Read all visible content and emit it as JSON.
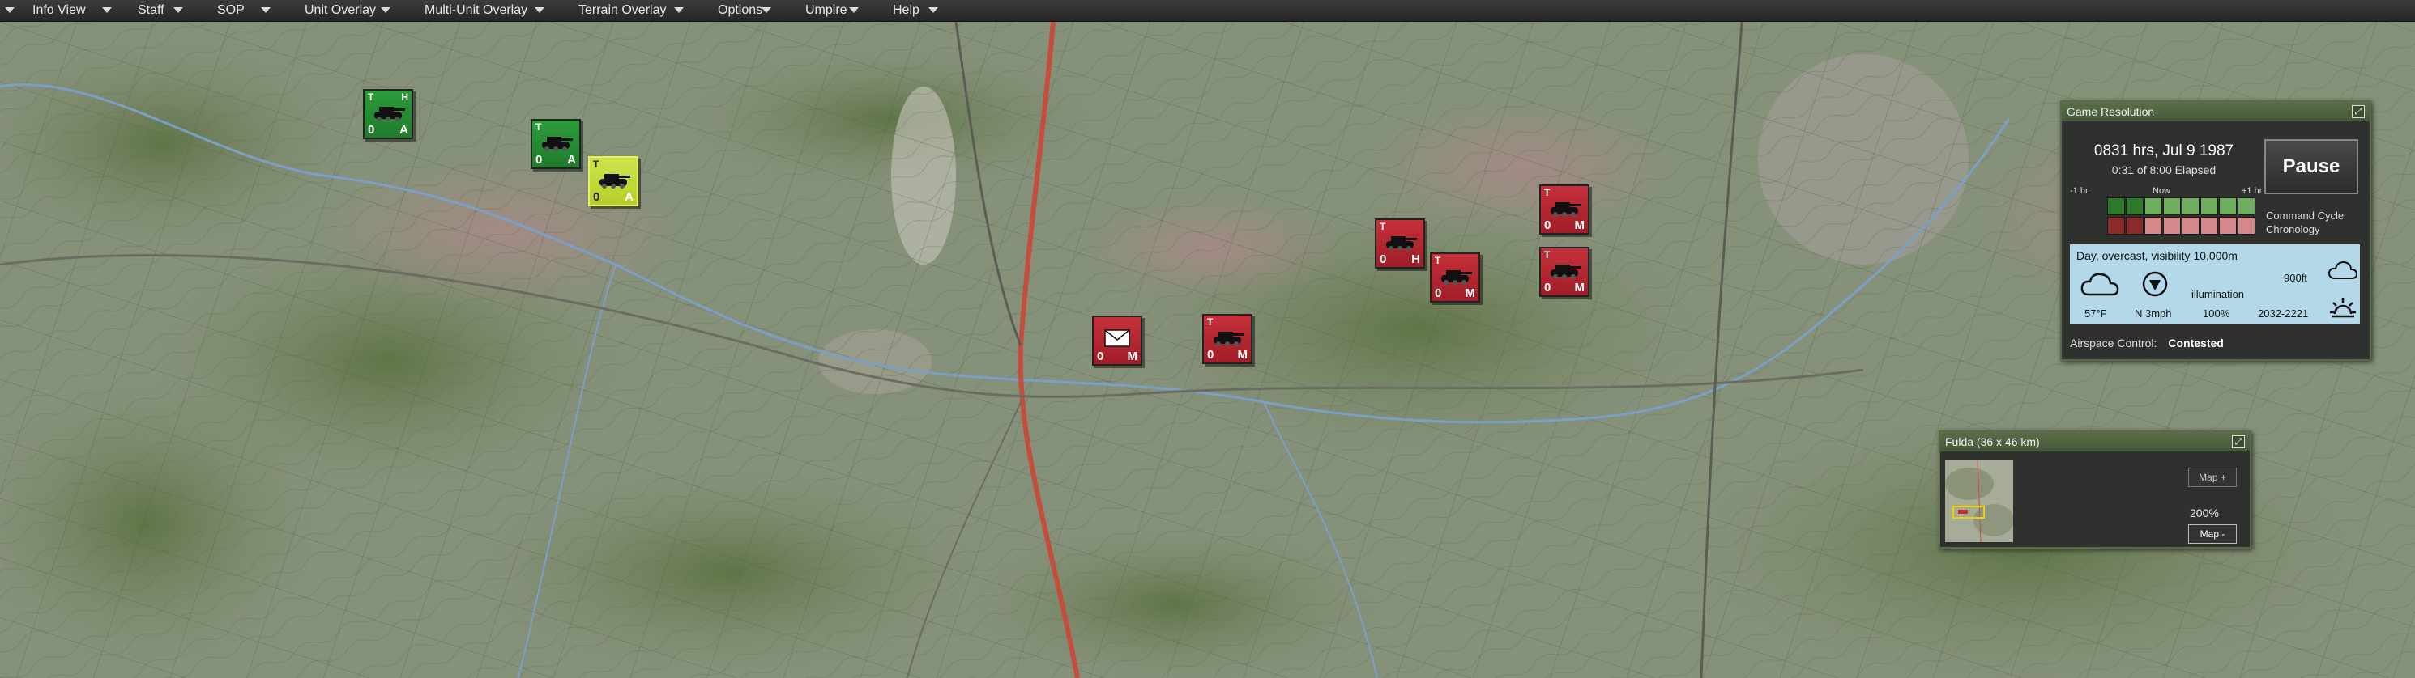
{
  "menu": {
    "items": [
      {
        "label": "Info View"
      },
      {
        "label": "Staff"
      },
      {
        "label": "SOP"
      },
      {
        "label": "Unit Overlay"
      },
      {
        "label": "Multi-Unit Overlay"
      },
      {
        "label": "Terrain Overlay"
      },
      {
        "label": "Options"
      },
      {
        "label": "Umpire"
      },
      {
        "label": "Help"
      }
    ]
  },
  "units": [
    {
      "side": "green",
      "top": "T",
      "top_right": "H",
      "strength": "0",
      "status": "A",
      "icon": "tank-icon"
    },
    {
      "side": "green",
      "top": "T",
      "top_right": "",
      "strength": "0",
      "status": "A",
      "icon": "tank-icon"
    },
    {
      "side": "yellow",
      "top": "T",
      "top_right": "",
      "strength": "0",
      "status": "A",
      "icon": "tank-icon"
    },
    {
      "side": "red",
      "top": "",
      "top_right": "",
      "strength": "0",
      "status": "M",
      "icon": "hq-envelope-icon"
    },
    {
      "side": "red",
      "top": "T",
      "top_right": "",
      "strength": "0",
      "status": "M",
      "icon": "tank-icon"
    },
    {
      "side": "red",
      "top": "T",
      "top_right": "",
      "strength": "0",
      "status": "H",
      "icon": "tank-icon"
    },
    {
      "side": "red",
      "top": "T",
      "top_right": "",
      "strength": "0",
      "status": "M",
      "icon": "tank-icon"
    },
    {
      "side": "red",
      "top": "T",
      "top_right": "",
      "strength": "0",
      "status": "M",
      "icon": "tank-icon"
    },
    {
      "side": "red",
      "top": "T",
      "top_right": "",
      "strength": "0",
      "status": "M",
      "icon": "tank-icon"
    }
  ],
  "game_resolution": {
    "title": "Game Resolution",
    "time": "0831 hrs, Jul 9 1987",
    "elapsed": "0:31 of 8:00 Elapsed",
    "pause_label": "Pause",
    "chron_minus": "-1 hr",
    "chron_now": "Now",
    "chron_plus": "+1 hr",
    "command_cycle": "Command Cycle",
    "chronology": "Chronology",
    "weather_text": "Day, overcast, visibility 10,000m",
    "temperature": "57°F",
    "wind": "N 3mph",
    "illumination_label": "illumination",
    "illumination": "100%",
    "cloud_ceiling": "900ft",
    "daylight": "2032-2221",
    "airspace_label": "Airspace Control:",
    "airspace_value": "Contested",
    "colors": {
      "green": "#2f7a2a",
      "red": "#8a2a2a",
      "light_green": "#6fae5f",
      "light_red": "#d48888"
    }
  },
  "minimap": {
    "title": "Fulda (36 x 46 km)",
    "map_plus": "Map +",
    "zoom": "200%",
    "map_minus": "Map -"
  }
}
